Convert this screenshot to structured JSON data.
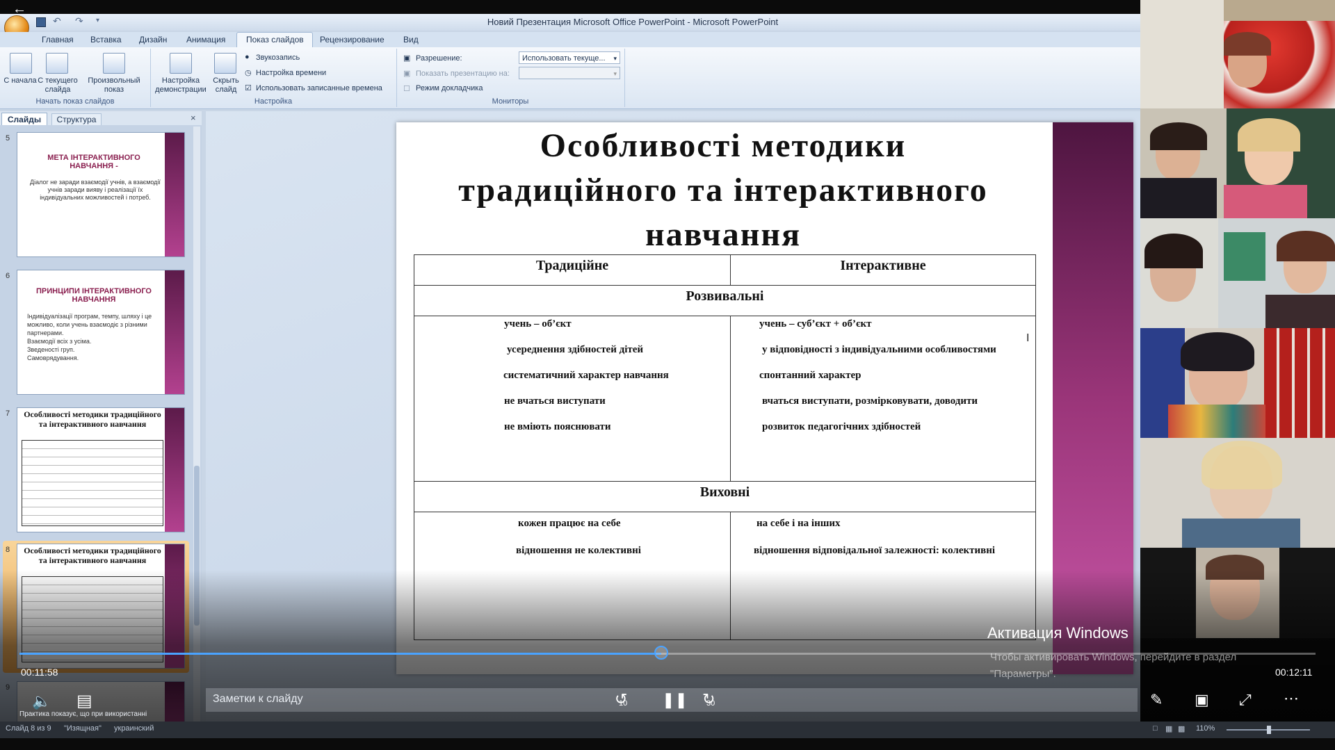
{
  "window": {
    "title": "Новий Презентация Microsoft Office PowerPoint - Microsoft PowerPoint"
  },
  "tabs": [
    "Главная",
    "Вставка",
    "Дизайн",
    "Анимация",
    "Показ слайдов",
    "Рецензирование",
    "Вид"
  ],
  "ribbon": {
    "group1": {
      "label": "Начать показ слайдов",
      "btn_start": "С начала",
      "btn_current": "С текущего слайда",
      "btn_custom": "Произвольный показ"
    },
    "group2": {
      "label": "Настройка",
      "btn_setup": "Настройка демонстрации",
      "btn_hide": "Скрыть слайд",
      "record": "Звукозапись",
      "timing": "Настройка времени",
      "use_timings": "Использовать записанные времена"
    },
    "group3": {
      "label": "Мониторы",
      "resolution_label": "Разрешение:",
      "resolution_value": "Использовать текуще...",
      "show_on_label": "Показать презентацию на:",
      "presenter_view": "Режим докладчика"
    }
  },
  "pane": {
    "tab_slides": "Слайды",
    "tab_outline": "Структура",
    "close": "×",
    "thumbs": [
      {
        "num": "5",
        "title": "МЕТА ІНТЕРАКТИВНОГО НАВЧАННЯ -",
        "body": "Діалог не заради взаємодії учнів, а взаємодії учнів заради вияву і реалізації їх індивідуальних можливостей і потреб."
      },
      {
        "num": "6",
        "title": "ПРИНЦИПИ ІНТЕРАКТИВНОГО НАВЧАННЯ",
        "bullets": [
          "Індивідуалізації програм, темпу, шляху і це можливо, коли учень взаємодіє з різними партнерами.",
          "Взаємодії всіх з усіма.",
          "Зведеності груп.",
          "Самоврядування."
        ]
      },
      {
        "num": "7",
        "title": "Особливості методики традиційного та інтерактивного навчання"
      },
      {
        "num": "8",
        "title": "Особливості методики традиційного та інтерактивного навчання"
      },
      {
        "num": "9"
      }
    ]
  },
  "slide": {
    "title_line1": "Особливості  методики",
    "title_line2": "традиційного  та  інтерактивного",
    "title_line3": "навчання",
    "col1": "Традиційне",
    "col2": "Інтерактивне",
    "section1": "Розвивальні",
    "section2": "Виховні",
    "dev_left": [
      "учень – об’єкт",
      "усереднення  здібностей  дітей",
      "систематичний  характер  навчання",
      "не  вчаться  виступати",
      "не  вміють  пояснювати"
    ],
    "dev_right": [
      "учень – суб’єкт + об’єкт",
      "у відповідності  з індивідуальними  особливостями",
      "спонтанний  характер",
      "вчаться виступати, розмірковувати, доводити",
      "розвиток  педагогічних  здібностей"
    ],
    "edu_left": [
      "кожен  працює  на  себе",
      "відношення  не  колективні"
    ],
    "edu_right": [
      "на  себе  і  на  інших",
      "відношення  відповідальної  залежності:  колективні"
    ]
  },
  "player": {
    "time_current": "00:11:58",
    "time_total": "00:12:11",
    "progress": 0.495,
    "notes": "Заметки к слайду",
    "rewind": "10",
    "forward": "30",
    "notes_preview": "Практика показує, що при використанні"
  },
  "status": {
    "slide": "Слайд 8 из 9",
    "theme": "\"Изящная\"",
    "lang": "украинский",
    "zoom": "110%"
  },
  "activation": {
    "title": "Активация Windows",
    "line1": "Чтобы активировать Windows, перейдите в раздел",
    "line2": "\"Параметры\"."
  },
  "colors": {
    "accent": "#4aa3ff",
    "slide_stripe": "#9a3579",
    "thumb_title": "#8a1f4f"
  }
}
